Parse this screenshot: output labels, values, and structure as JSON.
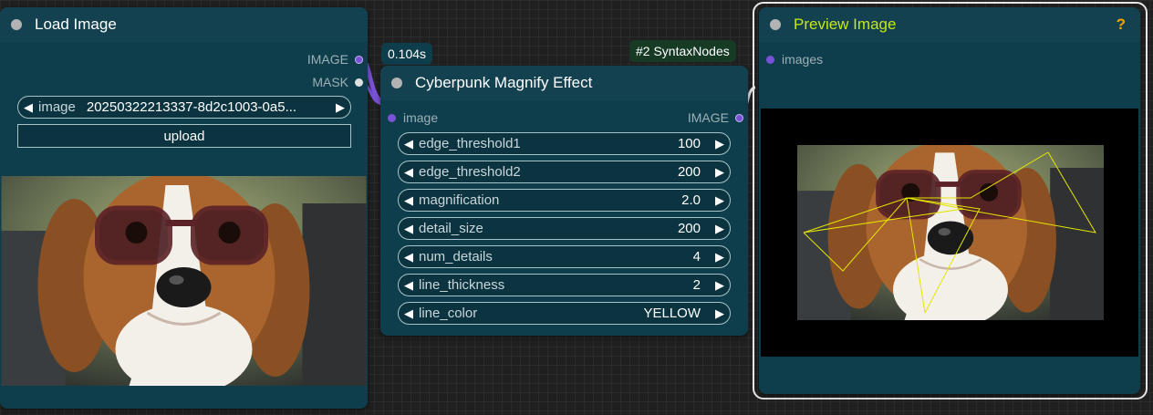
{
  "load_node": {
    "title": "Load Image",
    "outputs": [
      "IMAGE",
      "MASK"
    ],
    "image_widget": {
      "label": "image",
      "value": "20250322213337-8d2c1003-0a5..."
    },
    "upload_label": "upload"
  },
  "timing_badge": "0.104s",
  "source_badge": "#2 SyntaxNodes",
  "effect_node": {
    "title": "Cyberpunk Magnify Effect",
    "input_label": "image",
    "output_label": "IMAGE",
    "widgets": [
      {
        "label": "edge_threshold1",
        "value": "100"
      },
      {
        "label": "edge_threshold2",
        "value": "200"
      },
      {
        "label": "magnification",
        "value": "2.0"
      },
      {
        "label": "detail_size",
        "value": "200"
      },
      {
        "label": "num_details",
        "value": "4"
      },
      {
        "label": "line_thickness",
        "value": "2"
      },
      {
        "label": "line_color",
        "value": "YELLOW"
      }
    ]
  },
  "preview_node": {
    "title": "Preview Image",
    "help": "?",
    "input_label": "images"
  },
  "colors": {
    "node_bg": "#0e3e4c",
    "node_title_bg": "#13414f",
    "preview_title": "#c6e61d",
    "help": "#f5a300",
    "image_slot": "#7a52d8",
    "mask_slot": "#e0e0e0",
    "link": "#7a52d8",
    "line": "#e6e600"
  }
}
